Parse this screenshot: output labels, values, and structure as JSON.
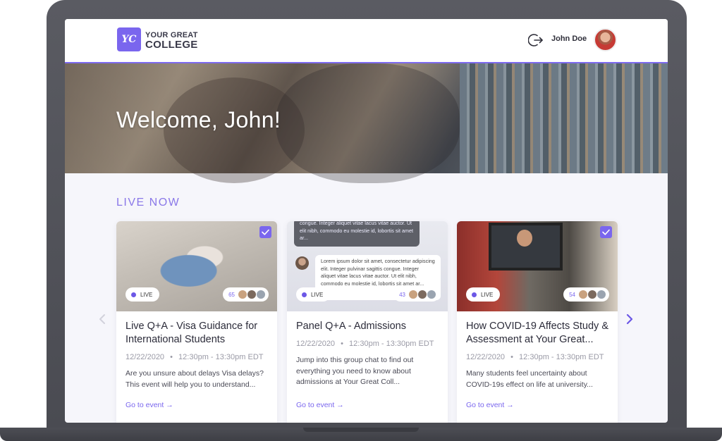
{
  "header": {
    "logo_badge": "YC",
    "logo_line1": "YOUR GREAT",
    "logo_line2": "COLLEGE",
    "user_name": "John Doe",
    "logout_icon": "logout-icon"
  },
  "hero": {
    "title": "Welcome, John!"
  },
  "section": {
    "title": "LIVE NOW"
  },
  "colors": {
    "accent": "#7a66ee",
    "header_border": "#7d6af0",
    "section_title": "#8a78e8"
  },
  "cards": [
    {
      "live_label": "LIVE",
      "viewers": "65",
      "title": "Live Q+A - Visa Guidance for International Students",
      "date": "12/22/2020",
      "time": "12:30pm - 13:30pm EDT",
      "description": "Are you unsure about delays Visa delays? This event will help you to understand...",
      "link": "Go to event →",
      "checked": true
    },
    {
      "live_label": "LIVE",
      "viewers": "43",
      "title": "Panel Q+A - Admissions",
      "date": "12/22/2020",
      "time": "12:30pm - 13:30pm EDT",
      "description": "Jump into this group chat to find out everything you need to know about admissions at Your Great Coll...",
      "link": "Go to event →",
      "checked": false,
      "chat_dark": "congue. Integer aliquet vitae lacus vitae auctor. Ut elit nibh, commodo eu molestie id, lobortis sit amet ar...",
      "chat_light": "Lorem ipsum dolor sit amet, consectetur adipiscing elit. Integer pulvinar sagittis congue. Integer aliquet vitae lacus vitae auctor. Ut elit nibh, commodo eu molestie id, lobortis sit amet ar..."
    },
    {
      "live_label": "LIVE",
      "viewers": "54",
      "title": "How COVID-19 Affects Study & Assessment at Your Great...",
      "date": "12/22/2020",
      "time": "12:30pm - 13:30pm EDT",
      "description": "Many students feel uncertainty about COVID-19s effect on life at university...",
      "link": "Go to event →",
      "checked": true
    }
  ],
  "meta_separator": "•"
}
